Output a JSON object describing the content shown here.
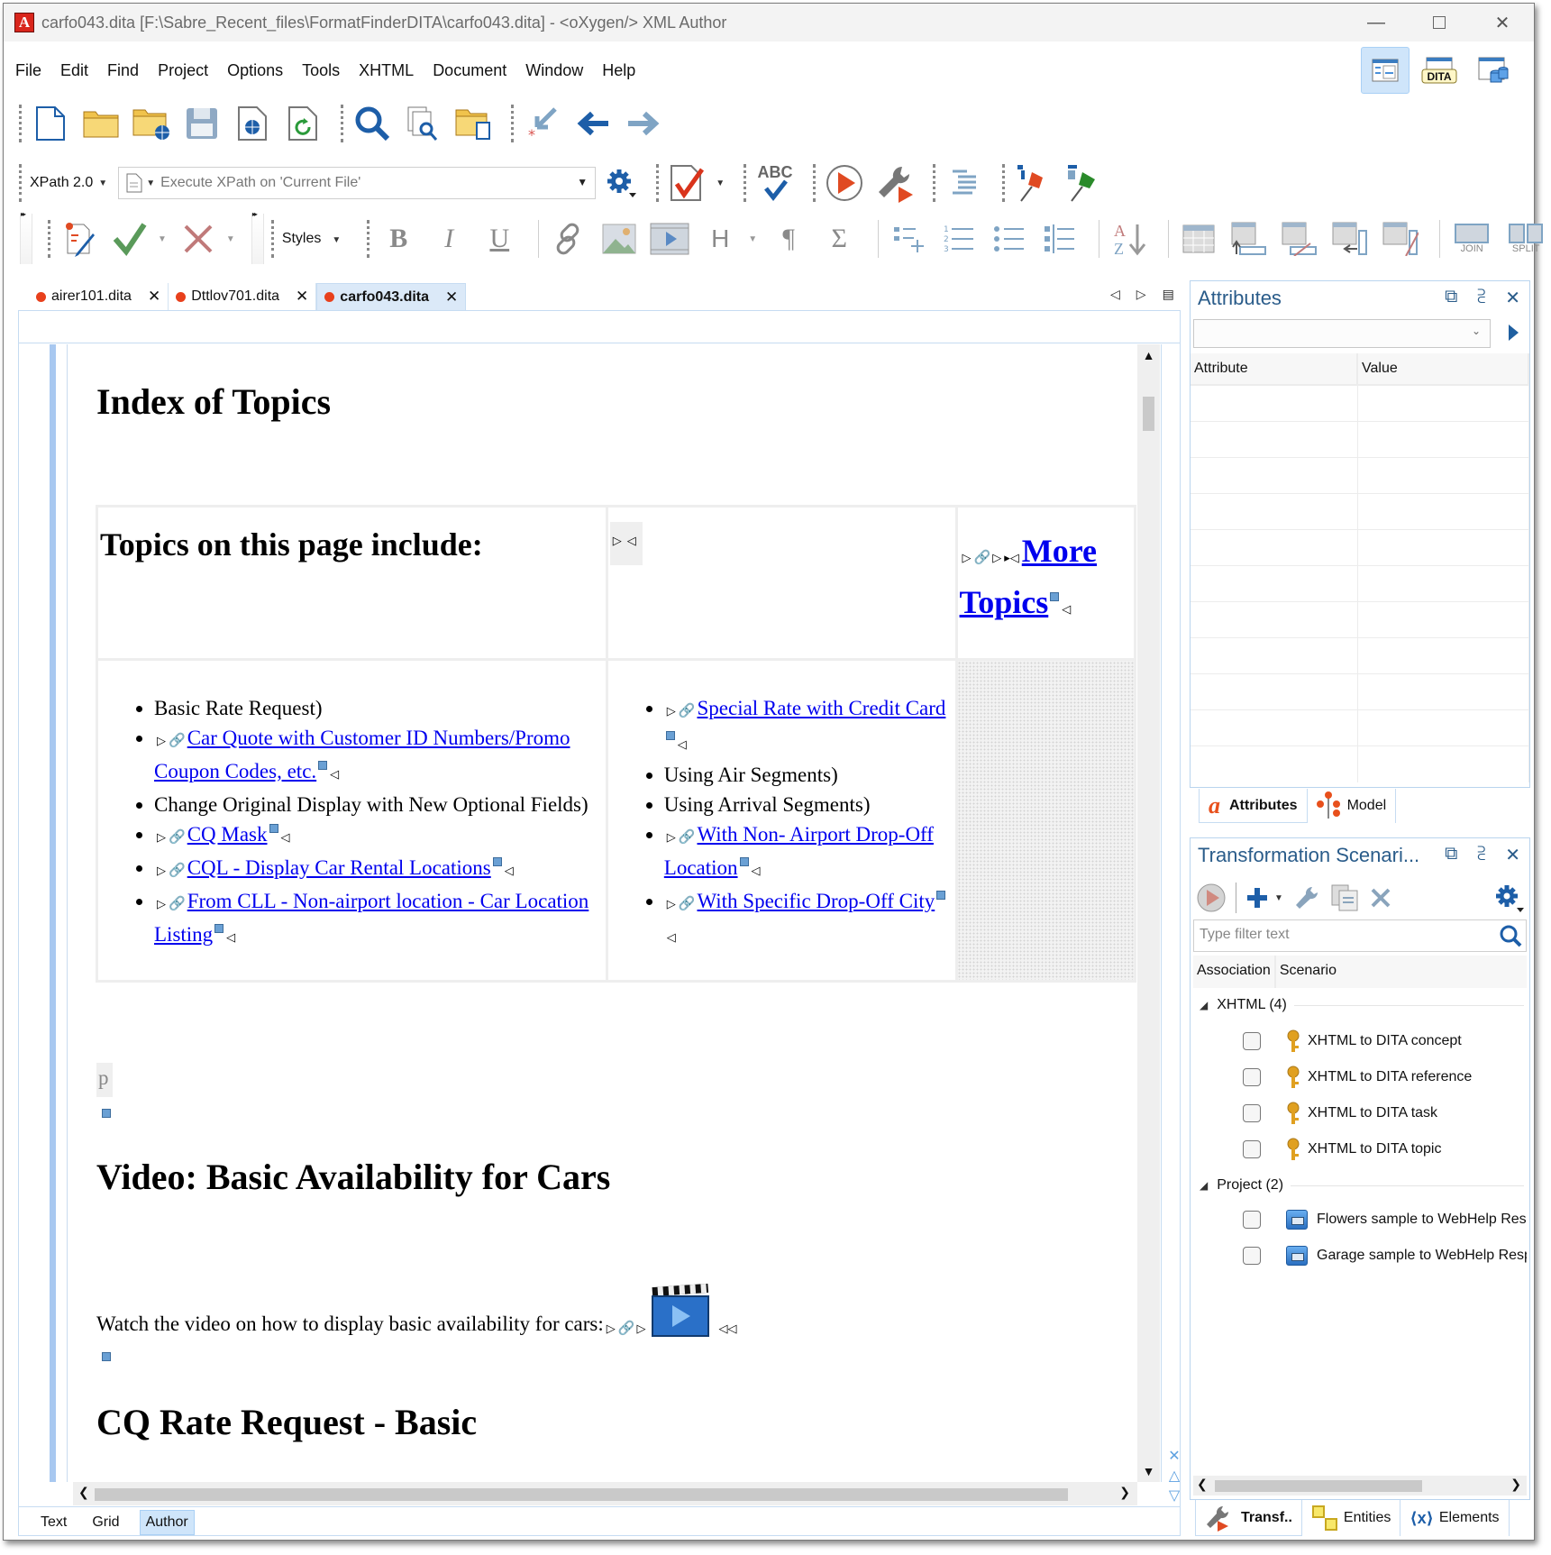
{
  "window": {
    "title": "carfo043.dita [F:\\Sabre_Recent_files\\FormatFinderDITA\\carfo043.dita] - <oXygen/> XML Author",
    "controls": [
      "minimize",
      "maximize",
      "close"
    ]
  },
  "menu": [
    "File",
    "Edit",
    "Find",
    "Project",
    "Options",
    "Tools",
    "XHTML",
    "Document",
    "Window",
    "Help"
  ],
  "perspectives": [
    {
      "name": "editor-perspective",
      "active": true
    },
    {
      "name": "dita-perspective",
      "label": "DITA",
      "active": false
    },
    {
      "name": "database-perspective",
      "active": false
    }
  ],
  "toolbar1": [
    "new-file",
    "open-file",
    "open-url",
    "save",
    "save-to-url",
    "reload",
    "find-replace",
    "find-in-files",
    "open-find-resource",
    "last-edit-location",
    "back",
    "forward"
  ],
  "toolbar2": {
    "xpath_version": "XPath 2.0",
    "xpath_placeholder": "Execute XPath on  'Current File'",
    "abc_label": "ABC"
  },
  "toolbar3": {
    "styles_label": "Styles",
    "bold": "B",
    "italic": "I",
    "underline": "U",
    "heading": "H",
    "paragraph": "¶",
    "sigma": "Σ",
    "join": "JOIN",
    "split": "SPLIT"
  },
  "doc_tabs": [
    {
      "label": "airer101.dita",
      "active": false
    },
    {
      "label": "Dttlov701.dita",
      "active": false
    },
    {
      "label": "carfo043.dita",
      "active": true
    }
  ],
  "document": {
    "heading1": "Index of Topics",
    "table_header_left": "Topics on this page include:",
    "more_topics_line1": "More",
    "more_topics_line2": "Topics",
    "left_list": [
      {
        "text": "Basic Rate Request)",
        "link": false
      },
      {
        "text": "Car Quote with Customer ID Numbers/Promo",
        "text2": "Coupon Codes, etc.",
        "link": true
      },
      {
        "text": "Change Original Display with New Optional Fields)",
        "link": false
      },
      {
        "text": "CQ Mask",
        "link": true
      },
      {
        "text": "CQL - Display Car Rental Locations",
        "link": true
      },
      {
        "text": "From CLL - Non-airport location - Car Location",
        "text2": "Listing",
        "link": true
      }
    ],
    "right_list": [
      {
        "text": "Special Rate with Credit Card",
        "link": true
      },
      {
        "text": "Using Air Segments)",
        "link": false
      },
      {
        "text": "Using Arrival Segments)",
        "link": false
      },
      {
        "text": "With Non- Airport Drop-Off",
        "text2": "Location",
        "link": true
      },
      {
        "text": "With Specific Drop-Off City",
        "link": true
      }
    ],
    "p_tag": "p",
    "heading2": "Video: Basic Availability for Cars",
    "video_para": "Watch the video on how to display basic availability for cars:",
    "heading3": "CQ Rate Request - Basic"
  },
  "mode_tabs": [
    {
      "label": "Text",
      "active": false
    },
    {
      "label": "Grid",
      "active": false
    },
    {
      "label": "Author",
      "active": true
    }
  ],
  "attributes_panel": {
    "title": "Attributes",
    "col_attribute": "Attribute",
    "col_value": "Value",
    "tabs": [
      {
        "label": "Attributes",
        "active": true
      },
      {
        "label": "Model",
        "active": false
      }
    ]
  },
  "transform_panel": {
    "title": "Transformation Scenari...",
    "filter_placeholder": "Type filter text",
    "col_association": "Association",
    "col_scenario": "Scenario",
    "groups": [
      {
        "label": "XHTML (4)",
        "items": [
          "XHTML to DITA concept",
          "XHTML to DITA reference",
          "XHTML to DITA task",
          "XHTML to DITA topic"
        ]
      },
      {
        "label": "Project (2)",
        "items": [
          "Flowers sample to WebHelp Responsive",
          "Garage sample to WebHelp Responsive"
        ]
      }
    ],
    "tabs": [
      {
        "label": "Transf..",
        "active": true
      },
      {
        "label": "Entities",
        "active": false
      },
      {
        "label": "Elements",
        "active": false
      }
    ]
  },
  "colors": {
    "accent": "#2a5c8a",
    "link": "#0000ee",
    "tab_dot": "#e8401c",
    "active_tab_bg": "#dbe9f8"
  }
}
